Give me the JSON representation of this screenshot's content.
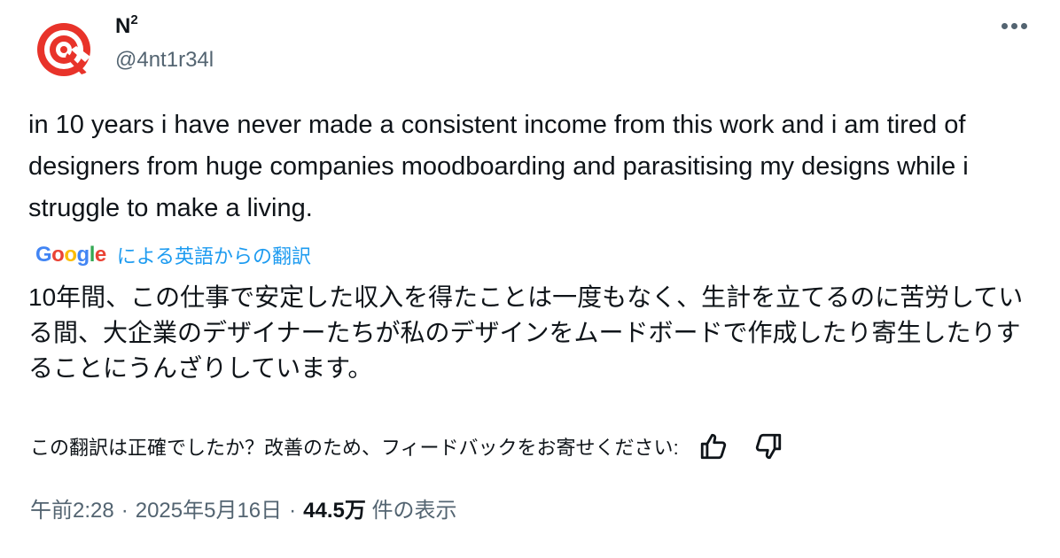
{
  "author": {
    "display_name": "N",
    "display_name_sup": "2",
    "handle": "@4nt1r34l",
    "avatar_icon": "red-spiral-logo-icon",
    "avatar_color": "#e8332a"
  },
  "menu_icon": "more-dots-icon",
  "tweet": {
    "text": "in 10 years i have never made a consistent income from this work and i am tired of designers from huge companies moodboarding and parasitising my designs while i struggle to make a living."
  },
  "translation": {
    "provider": {
      "g1": "G",
      "o1": "o",
      "o2": "o",
      "g2": "g",
      "l": "l",
      "e": "e"
    },
    "label": "による英語からの翻訳",
    "text": "10年間、この仕事で安定した収入を得たことは一度もなく、生計を立てるのに苦労している間、大企業のデザイナーたちが私のデザインをムードボードで作成したり寄生したりすることにうんざりしています。"
  },
  "feedback": {
    "question": "この翻訳は正確でしたか？改善のため、フィードバックをお寄せください:",
    "thumbs_up_icon": "thumbs-up-icon",
    "thumbs_down_icon": "thumbs-down-icon"
  },
  "meta": {
    "time": "午前2:28",
    "separator": "·",
    "date": "2025年5月16日",
    "views_count": "44.5万",
    "views_label": "件の表示"
  }
}
